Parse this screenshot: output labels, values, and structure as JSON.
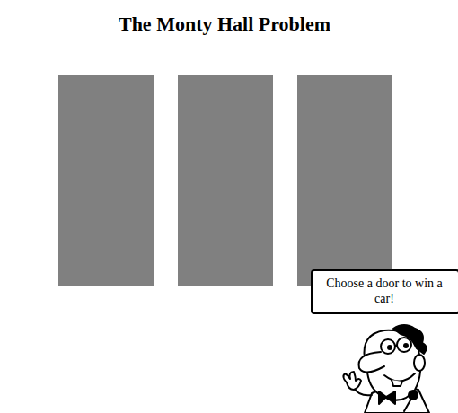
{
  "title": "The Monty Hall Problem",
  "doors": [
    {
      "selected": false
    },
    {
      "selected": false
    },
    {
      "selected": false
    }
  ],
  "host": {
    "speech": "Choose a door to win a car!"
  }
}
